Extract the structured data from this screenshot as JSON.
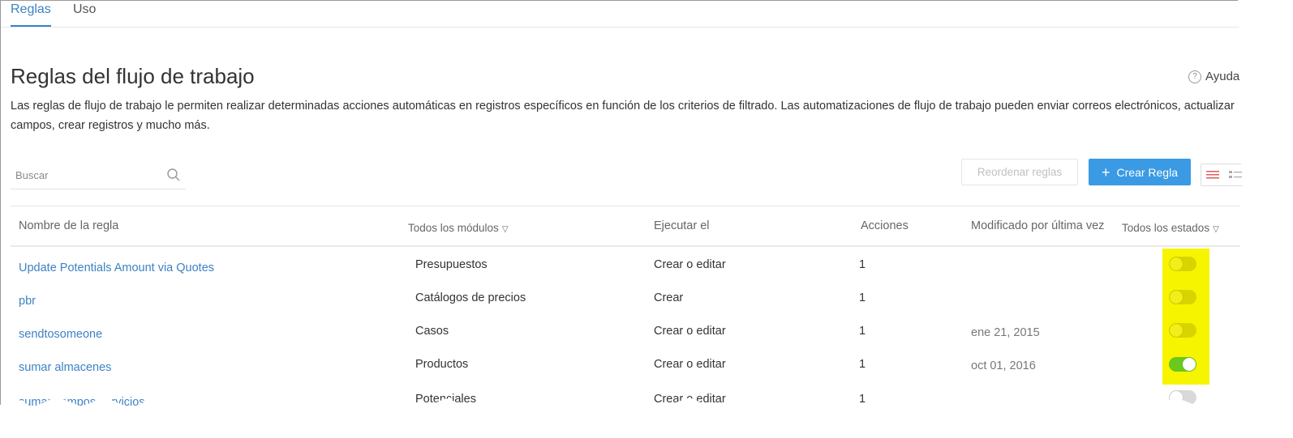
{
  "tabs": [
    {
      "label": "Reglas",
      "active": true
    },
    {
      "label": "Uso",
      "active": false
    }
  ],
  "page": {
    "title": "Reglas del flujo de trabajo",
    "help_label": "Ayuda",
    "description": "Las reglas de flujo de trabajo le permiten realizar determinadas acciones automáticas en registros específicos en función de los criterios de filtrado. Las automatizaciones de flujo de trabajo pueden enviar correos electrónicos, actualizar campos, crear registros y mucho más."
  },
  "search": {
    "placeholder": "Buscar",
    "value": ""
  },
  "toolbar": {
    "reorder_label": "Reordenar reglas",
    "create_label": "Crear Regla"
  },
  "table": {
    "headers": {
      "name": "Nombre de la regla",
      "module": "Todos los módulos",
      "execute": "Ejecutar el",
      "actions": "Acciones",
      "modified": "Modificado por última vez",
      "status": "Todos los estados"
    },
    "rows": [
      {
        "name": "Update Potentials Amount via Quotes",
        "module": "Presupuestos",
        "execute": "Crear o editar",
        "actions": "1",
        "modified": "",
        "active": false
      },
      {
        "name": "pbr",
        "module": "Catálogos de precios",
        "execute": "Crear",
        "actions": "1",
        "modified": "",
        "active": false
      },
      {
        "name": "sendtosomeone",
        "module": "Casos",
        "execute": "Crear o editar",
        "actions": "1",
        "modified": "ene 21, 2015",
        "active": false
      },
      {
        "name": "sumar almacenes",
        "module": "Productos",
        "execute": "Crear o editar",
        "actions": "1",
        "modified": "oct 01, 2016",
        "active": true
      },
      {
        "name": "sumar campos servicios",
        "module": "Potenciales",
        "execute": "Crear o editar",
        "actions": "1",
        "modified": "",
        "active": false
      }
    ]
  },
  "colors": {
    "accent": "#3d82c4",
    "primary_button": "#3a9ae3",
    "highlight": "#f7f400",
    "toggle_on": "#6bc81c",
    "toggle_off": "#d9d9d9"
  }
}
